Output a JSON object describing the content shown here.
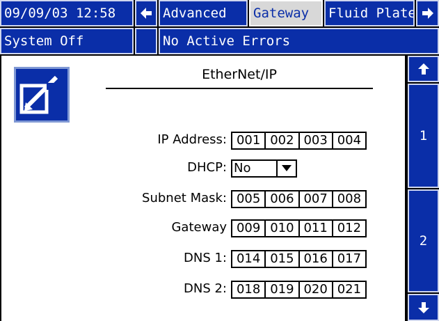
{
  "header": {
    "datetime": "09/09/03 12:58",
    "nav_left_icon": "arrow-left-icon",
    "tabs": [
      {
        "label": "Advanced",
        "active": false
      },
      {
        "label": "Gateway",
        "active": true
      },
      {
        "label": "Fluid Plate",
        "active": false
      }
    ],
    "nav_right_icon": "arrow-right-icon"
  },
  "status": {
    "system_state": "System Off",
    "errors": "No Active Errors"
  },
  "sidebar": {
    "up_icon": "arrow-up-icon",
    "pages": [
      "1",
      "2"
    ],
    "down_icon": "arrow-down-icon"
  },
  "main": {
    "edit_icon": "edit-pencil-icon",
    "title": "EtherNet/IP",
    "fields": {
      "ip": {
        "label": "IP Address:",
        "octets": [
          "001",
          "002",
          "003",
          "004"
        ]
      },
      "dhcp": {
        "label": "DHCP:",
        "value": "No"
      },
      "subnet": {
        "label": "Subnet Mask:",
        "octets": [
          "005",
          "006",
          "007",
          "008"
        ]
      },
      "gateway": {
        "label": "Gateway",
        "octets": [
          "009",
          "010",
          "011",
          "012"
        ]
      },
      "dns1": {
        "label": "DNS 1:",
        "octets": [
          "014",
          "015",
          "016",
          "017"
        ]
      },
      "dns2": {
        "label": "DNS 2:",
        "octets": [
          "018",
          "019",
          "020",
          "021"
        ]
      }
    }
  },
  "colors": {
    "panel_blue": "#0a2ea8",
    "active_tab": "#d8d8d8",
    "background": "#ffffff"
  }
}
